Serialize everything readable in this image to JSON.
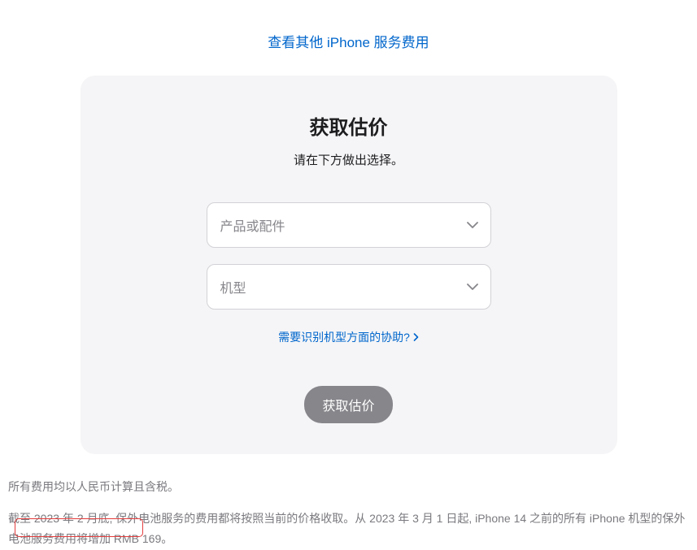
{
  "topLink": {
    "label": "查看其他 iPhone 服务费用"
  },
  "card": {
    "title": "获取估价",
    "subtitle": "请在下方做出选择。",
    "productSelect": {
      "placeholder": "产品或配件"
    },
    "modelSelect": {
      "placeholder": "机型"
    },
    "helpLink": {
      "label": "需要识别机型方面的协助?"
    },
    "button": {
      "label": "获取估价"
    }
  },
  "footer": {
    "line1": "所有费用均以人民币计算且含税。",
    "line2": "截至 2023 年 2 月底, 保外电池服务的费用都将按照当前的价格收取。从 2023 年 3 月 1 日起, iPhone 14 之前的所有 iPhone 机型的保外电池服务费用将增加 RMB 169。"
  }
}
